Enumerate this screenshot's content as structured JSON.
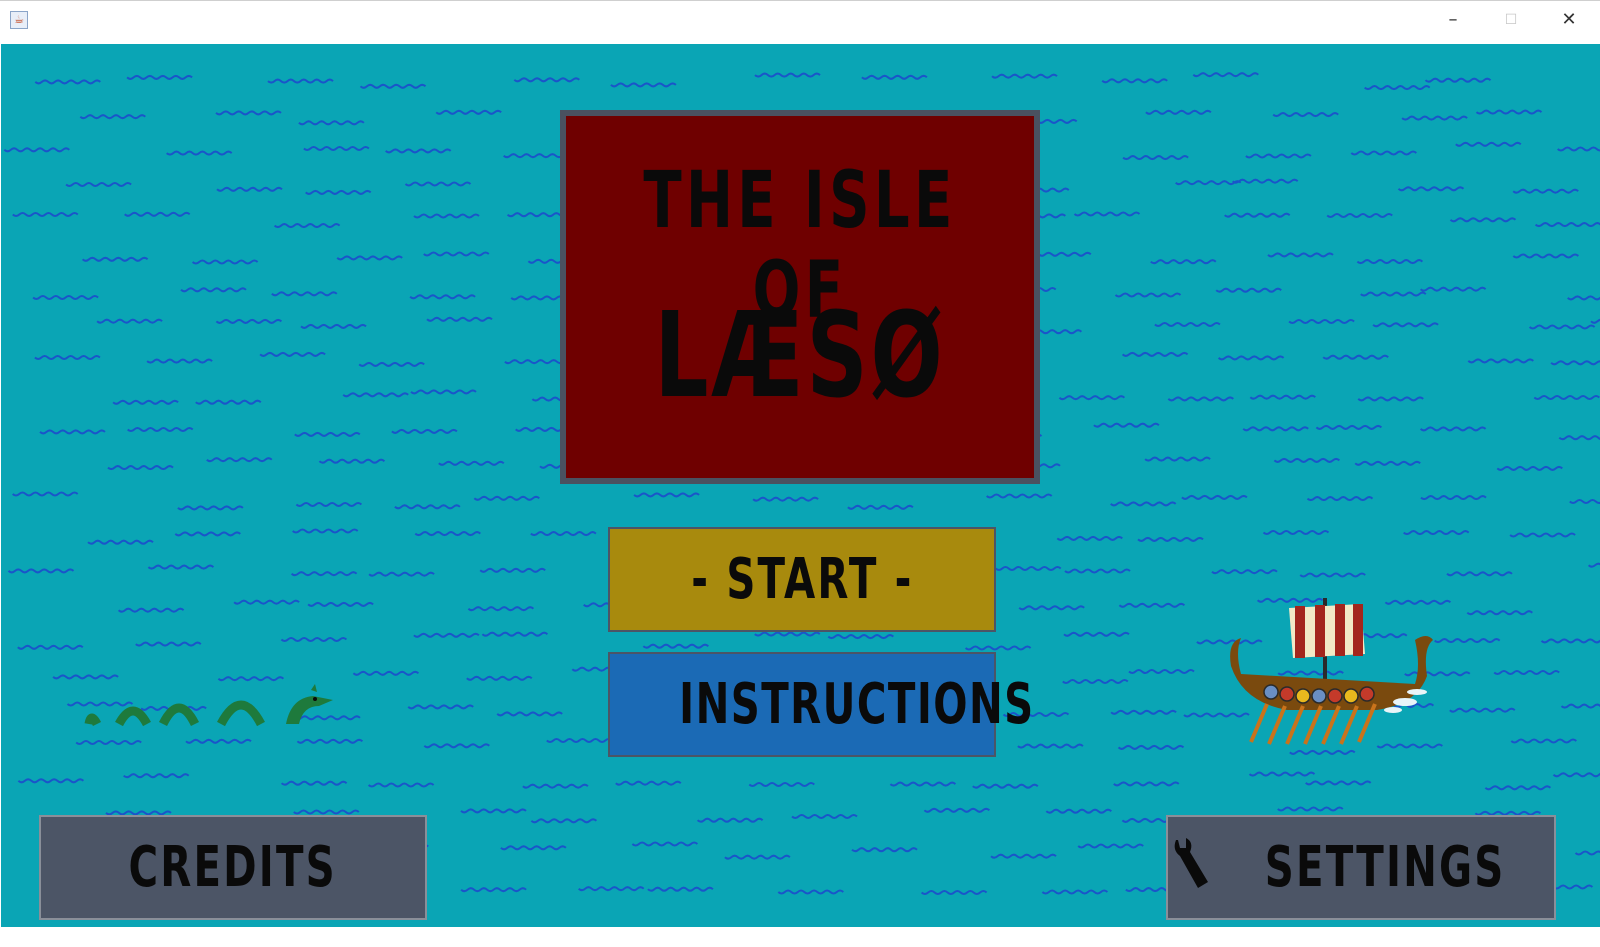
{
  "window": {
    "app_icon": "java-cup-icon",
    "controls": {
      "minimize": "–",
      "maximize": "☐",
      "close": "✕"
    }
  },
  "game": {
    "title_line1": "THE ISLE OF",
    "title_line2": "LÆSØ",
    "start_label": "- START -",
    "instructions_label": "INSTRUCTIONS",
    "credits_label": "CREDITS",
    "settings_label": "SETTINGS",
    "settings_icon": "wrench-icon",
    "colors": {
      "sea": "#0aa5b5",
      "waves": "#1a55c9",
      "title_panel": "#6f0000",
      "start_button": "#a88a0d",
      "instructions_button": "#1b6ab5",
      "secondary_button": "#4c5566"
    }
  }
}
